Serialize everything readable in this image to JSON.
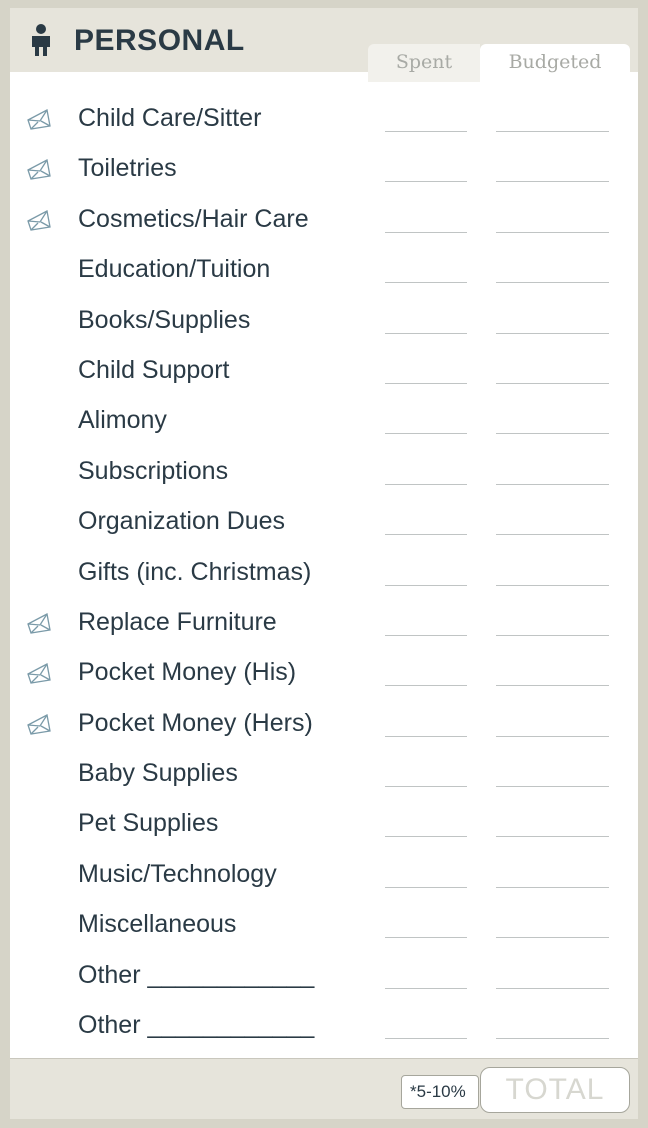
{
  "section": {
    "title": "PERSONAL",
    "icon": "person-icon"
  },
  "tabs": {
    "spent": "Spent",
    "budgeted": "Budgeted"
  },
  "rows": [
    {
      "label": "Child Care/Sitter",
      "envelope": true
    },
    {
      "label": "Toiletries",
      "envelope": true
    },
    {
      "label": "Cosmetics/Hair Care",
      "envelope": true
    },
    {
      "label": "Education/Tuition",
      "envelope": false
    },
    {
      "label": "Books/Supplies",
      "envelope": false
    },
    {
      "label": "Child Support",
      "envelope": false
    },
    {
      "label": "Alimony",
      "envelope": false
    },
    {
      "label": "Subscriptions",
      "envelope": false
    },
    {
      "label": "Organization Dues",
      "envelope": false
    },
    {
      "label": "Gifts (inc. Christmas)",
      "envelope": false
    },
    {
      "label": "Replace Furniture",
      "envelope": true
    },
    {
      "label": "Pocket Money (His)",
      "envelope": true
    },
    {
      "label": "Pocket Money (Hers)",
      "envelope": true
    },
    {
      "label": "Baby Supplies",
      "envelope": false
    },
    {
      "label": "Pet Supplies",
      "envelope": false
    },
    {
      "label": "Music/Technology",
      "envelope": false
    },
    {
      "label": "Miscellaneous",
      "envelope": false
    },
    {
      "label": "Other ____________",
      "envelope": false
    },
    {
      "label": "Other ____________",
      "envelope": false
    }
  ],
  "footer": {
    "percentage": "*5-10%",
    "total_label": "TOTAL"
  },
  "colors": {
    "frame": "#d6d4c8",
    "header_bg": "#e6e4db",
    "text": "#2a3a45",
    "envelope_icon": "#7a9aa8",
    "placeholder": "#d7d7d0"
  }
}
